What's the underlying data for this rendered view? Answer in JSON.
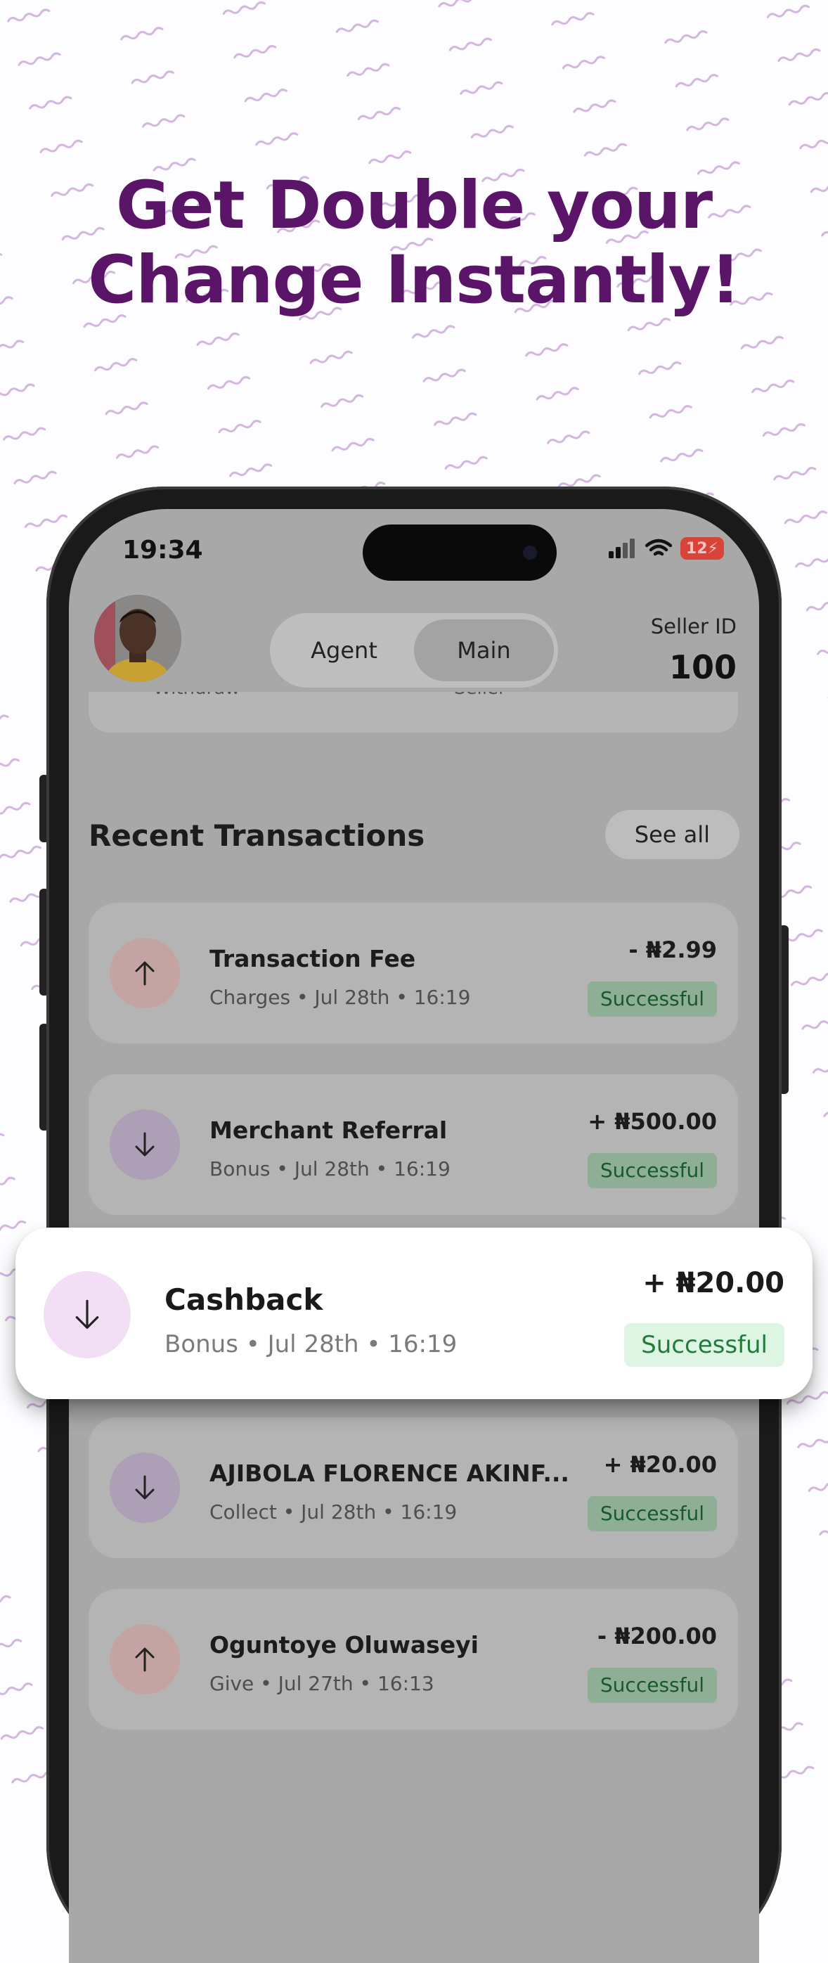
{
  "headline": {
    "line1": "Get Double your",
    "line2": "Change Instantly!"
  },
  "status_bar": {
    "time": "19:34",
    "battery": "12",
    "icons": [
      "signal-icon",
      "wifi-icon",
      "battery-icon"
    ]
  },
  "header": {
    "tabs": [
      {
        "label": "Agent",
        "active": false
      },
      {
        "label": "Main",
        "active": true
      }
    ],
    "seller_id_label": "Seller ID",
    "seller_id_value": "100"
  },
  "partial_card": {
    "left_label": "Withdraw",
    "right_label": "Seller"
  },
  "recent": {
    "title": "Recent Transactions",
    "see_all": "See all"
  },
  "transactions": [
    {
      "name": "Transaction Fee",
      "subtitle": "Charges • Jul 28th • 16:19",
      "amount": "- ₦2.99",
      "status": "Successful",
      "direction": "up"
    },
    {
      "name": "Merchant Referral",
      "subtitle": "Bonus • Jul 28th • 16:19",
      "amount": "+ ₦500.00",
      "status": "Successful",
      "direction": "down"
    },
    {
      "name": "AJIBOLA FLORENCE AKINF...",
      "subtitle": "Collect • Jul 28th • 16:19",
      "amount": "+ ₦20.00",
      "status": "Successful",
      "direction": "down"
    },
    {
      "name": "Oguntoye Oluwaseyi",
      "subtitle": "Give • Jul 27th • 16:13",
      "amount": "- ₦200.00",
      "status": "Successful",
      "direction": "up"
    }
  ],
  "highlight": {
    "name": "Cashback",
    "subtitle": "Bonus • Jul 28th • 16:19",
    "amount": "+ ₦20.00",
    "status": "Successful",
    "direction": "down"
  },
  "colors": {
    "brand_purple": "#5a1468",
    "success_green": "#1e7d3a",
    "success_bg": "#dff5e3"
  }
}
